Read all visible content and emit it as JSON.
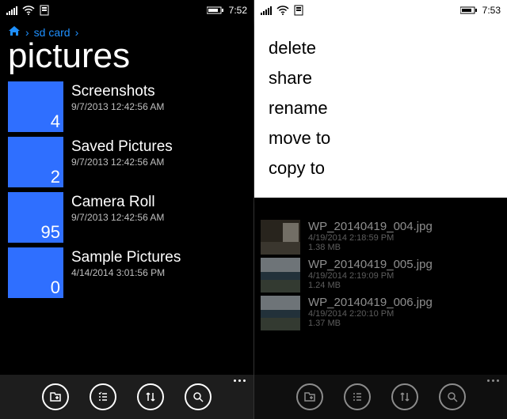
{
  "left": {
    "status": {
      "time": "7:52"
    },
    "breadcrumb": {
      "root": "sd card"
    },
    "title": "pictures",
    "folders": [
      {
        "name": "Screenshots",
        "date": "9/7/2013 12:42:56 AM",
        "count": "4"
      },
      {
        "name": "Saved Pictures",
        "date": "9/7/2013 12:42:56 AM",
        "count": "2"
      },
      {
        "name": "Camera Roll",
        "date": "9/7/2013 12:42:56 AM",
        "count": "95"
      },
      {
        "name": "Sample Pictures",
        "date": "4/14/2014 3:01:56 PM",
        "count": "0"
      }
    ]
  },
  "right": {
    "status": {
      "time": "7:53"
    },
    "menu": [
      "delete",
      "share",
      "rename",
      "move to",
      "copy to"
    ],
    "files": [
      {
        "name": "WP_20140419_004.jpg",
        "date": "4/19/2014 2:18:59 PM",
        "size": "1.38 MB"
      },
      {
        "name": "WP_20140419_005.jpg",
        "date": "4/19/2014 2:19:09 PM",
        "size": "1.24 MB"
      },
      {
        "name": "WP_20140419_006.jpg",
        "date": "4/19/2014 2:20:10 PM",
        "size": "1.37 MB"
      }
    ]
  }
}
